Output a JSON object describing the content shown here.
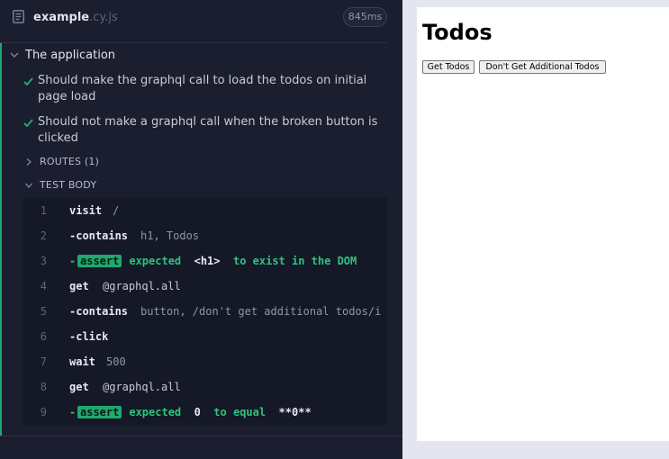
{
  "spec": {
    "name": "example",
    "ext": ".cy.js",
    "duration": "845ms"
  },
  "suite": {
    "title": "The application",
    "tests": [
      {
        "title": "Should make the graphql call to load the todos on initial page load",
        "state": "passed"
      },
      {
        "title": "Should not make a graphql call when the broken button is clicked",
        "state": "passed"
      }
    ],
    "routes_label": "ROUTES (1)",
    "test_body_label": "TEST BODY"
  },
  "commands": [
    {
      "n": "1",
      "name": "visit",
      "message": "/"
    },
    {
      "n": "2",
      "name": "-contains",
      "message": "h1, Todos"
    },
    {
      "n": "3",
      "name": "-",
      "badge": "assert",
      "expected": "expected",
      "subject": "<h1>",
      "rest": "to exist in the DOM"
    },
    {
      "n": "4",
      "name": "get",
      "message": "@graphql.all"
    },
    {
      "n": "5",
      "name": "-contains",
      "message": "button, /don't get additional todos/i"
    },
    {
      "n": "6",
      "name": "-click",
      "message": ""
    },
    {
      "n": "7",
      "name": "wait",
      "message": "500"
    },
    {
      "n": "8",
      "name": "get",
      "message": "@graphql.all"
    },
    {
      "n": "9",
      "name": "-",
      "badge": "assert",
      "expected": "expected",
      "subject": "0",
      "rest": "to equal",
      "value": "**0**"
    }
  ],
  "app": {
    "title": "Todos",
    "buttons": [
      "Get Todos",
      "Don't Get Additional Todos"
    ]
  },
  "colors": {
    "pass": "#1fa971",
    "panel": "#1b1e2e",
    "log": "#151826"
  },
  "icons": [
    "file-icon",
    "chevron-down-icon",
    "chevron-right-icon",
    "check-icon"
  ]
}
